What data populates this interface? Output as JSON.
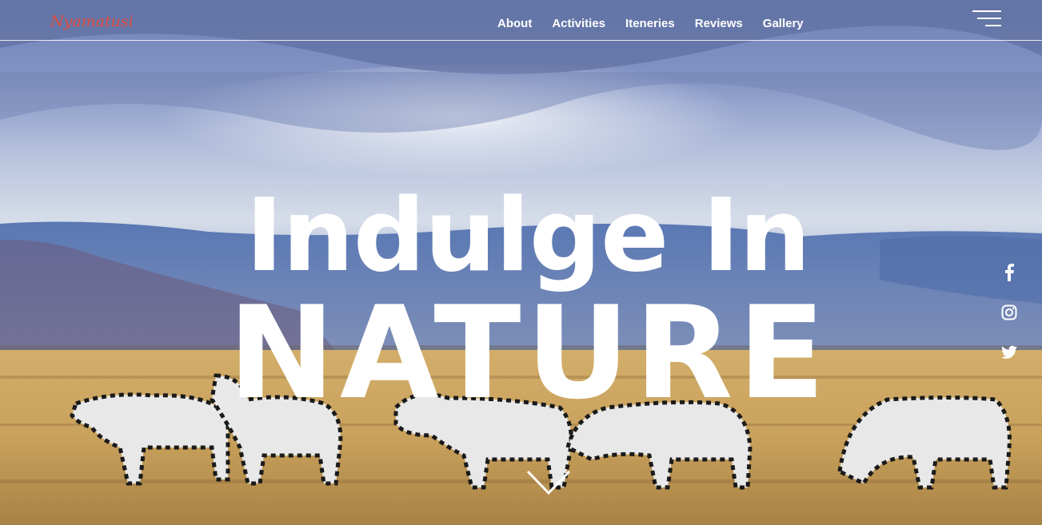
{
  "brand": {
    "logo_text": "Nyamatusi",
    "logo_color": "#e14a3c"
  },
  "nav": {
    "items": [
      {
        "label": "About"
      },
      {
        "label": "Activities"
      },
      {
        "label": "Iteneries"
      },
      {
        "label": "Reviews"
      },
      {
        "label": "Gallery"
      }
    ],
    "menu_icon": "hamburger-icon"
  },
  "hero": {
    "line1": "Indulge In",
    "line2": "NATURE",
    "scroll_icon": "chevron-down-icon"
  },
  "social": [
    {
      "name": "facebook-icon"
    },
    {
      "name": "instagram-icon"
    },
    {
      "name": "twitter-icon"
    }
  ],
  "colors": {
    "text": "#ffffff",
    "sky": "#7f93c4",
    "grass": "#c9a464"
  }
}
